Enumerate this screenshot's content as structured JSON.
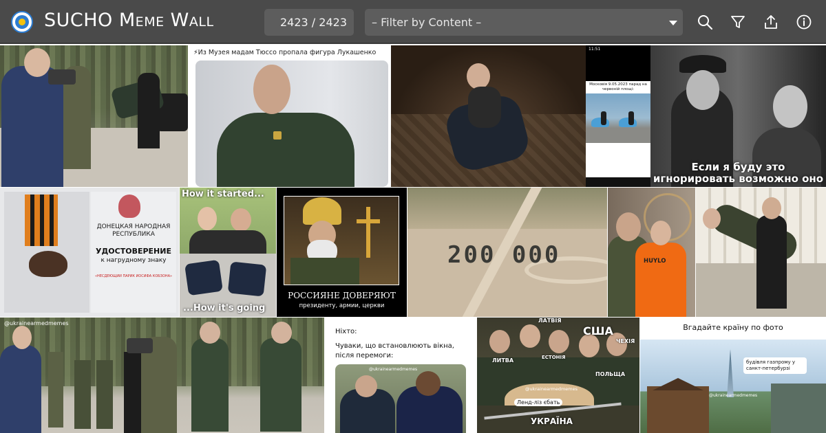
{
  "header": {
    "title_first": "SUCHO ",
    "title_second": "Meme Wall",
    "counter": "2423 / 2423",
    "filter_placeholder": "– Filter by Content –"
  },
  "icons": [
    "sucho-logo-icon",
    "search-icon",
    "filter-icon",
    "share-icon",
    "info-icon"
  ],
  "colors": {
    "header_bg": "#4a4a4a",
    "control_bg": "#5d5d5d",
    "logo_blue": "#2d7dd2",
    "logo_yellow": "#f4c20d"
  },
  "tiles": {
    "t2": {
      "caption": "⚡Из Музея мадам Тюссо пропала фигура Лукашенко"
    },
    "t4": {
      "caption": "Московія 9.05.2023 парад на червоній площі:",
      "status": "11:51"
    },
    "t5": {
      "caption": "Если я буду это игнорировать возможно оно исчезнет"
    },
    "t6": {
      "line1": "ДОНЕЦКАЯ НАРОДНАЯ",
      "line2": "РЕСПУБЛИКА",
      "line3": "УДОСТОВЕРЕНИЕ",
      "line4": "к нагрудному знаку",
      "line5": "«НЕСДЕЮЩИЙ ПАРИК ИОСИФА КОБЗОНА»"
    },
    "t7": {
      "top": "How it started...",
      "bottom": "...How it's going"
    },
    "t8": {
      "line1": "РОССИЯНЕ ДОВЕРЯЮТ",
      "line2": "президенту, армии, церкви"
    },
    "t9": {
      "text": "200 000"
    },
    "t10": {
      "prison_label": "HUYLO"
    },
    "t12": {
      "watermark": "@ukrainearmedmemes"
    },
    "t13": {
      "line1": "Ніхто:",
      "line2": "Чуваки, що встановлюють вікна, після перемоги:",
      "watermark": "@ukrainearmedmemes"
    },
    "t14": {
      "l_latvia": "ЛАТВІЯ",
      "l_usa": "США",
      "l_czech": "ЧЕХІЯ",
      "l_lithuania": "ЛИТВА",
      "l_estonia": "ЕСТОНІЯ",
      "l_poland": "ПОЛЬЩА",
      "l_watermark": "@ukrainearmedmemes",
      "l_bubble": "Ленд-ліз єбать",
      "l_ukraine": "УКРАЇНА"
    },
    "t15": {
      "title": "Вгадайте країну по фото",
      "bubble": "будівля газпрому у санкт-петербурзі",
      "watermark": "@ukrainearmedmemes"
    }
  }
}
